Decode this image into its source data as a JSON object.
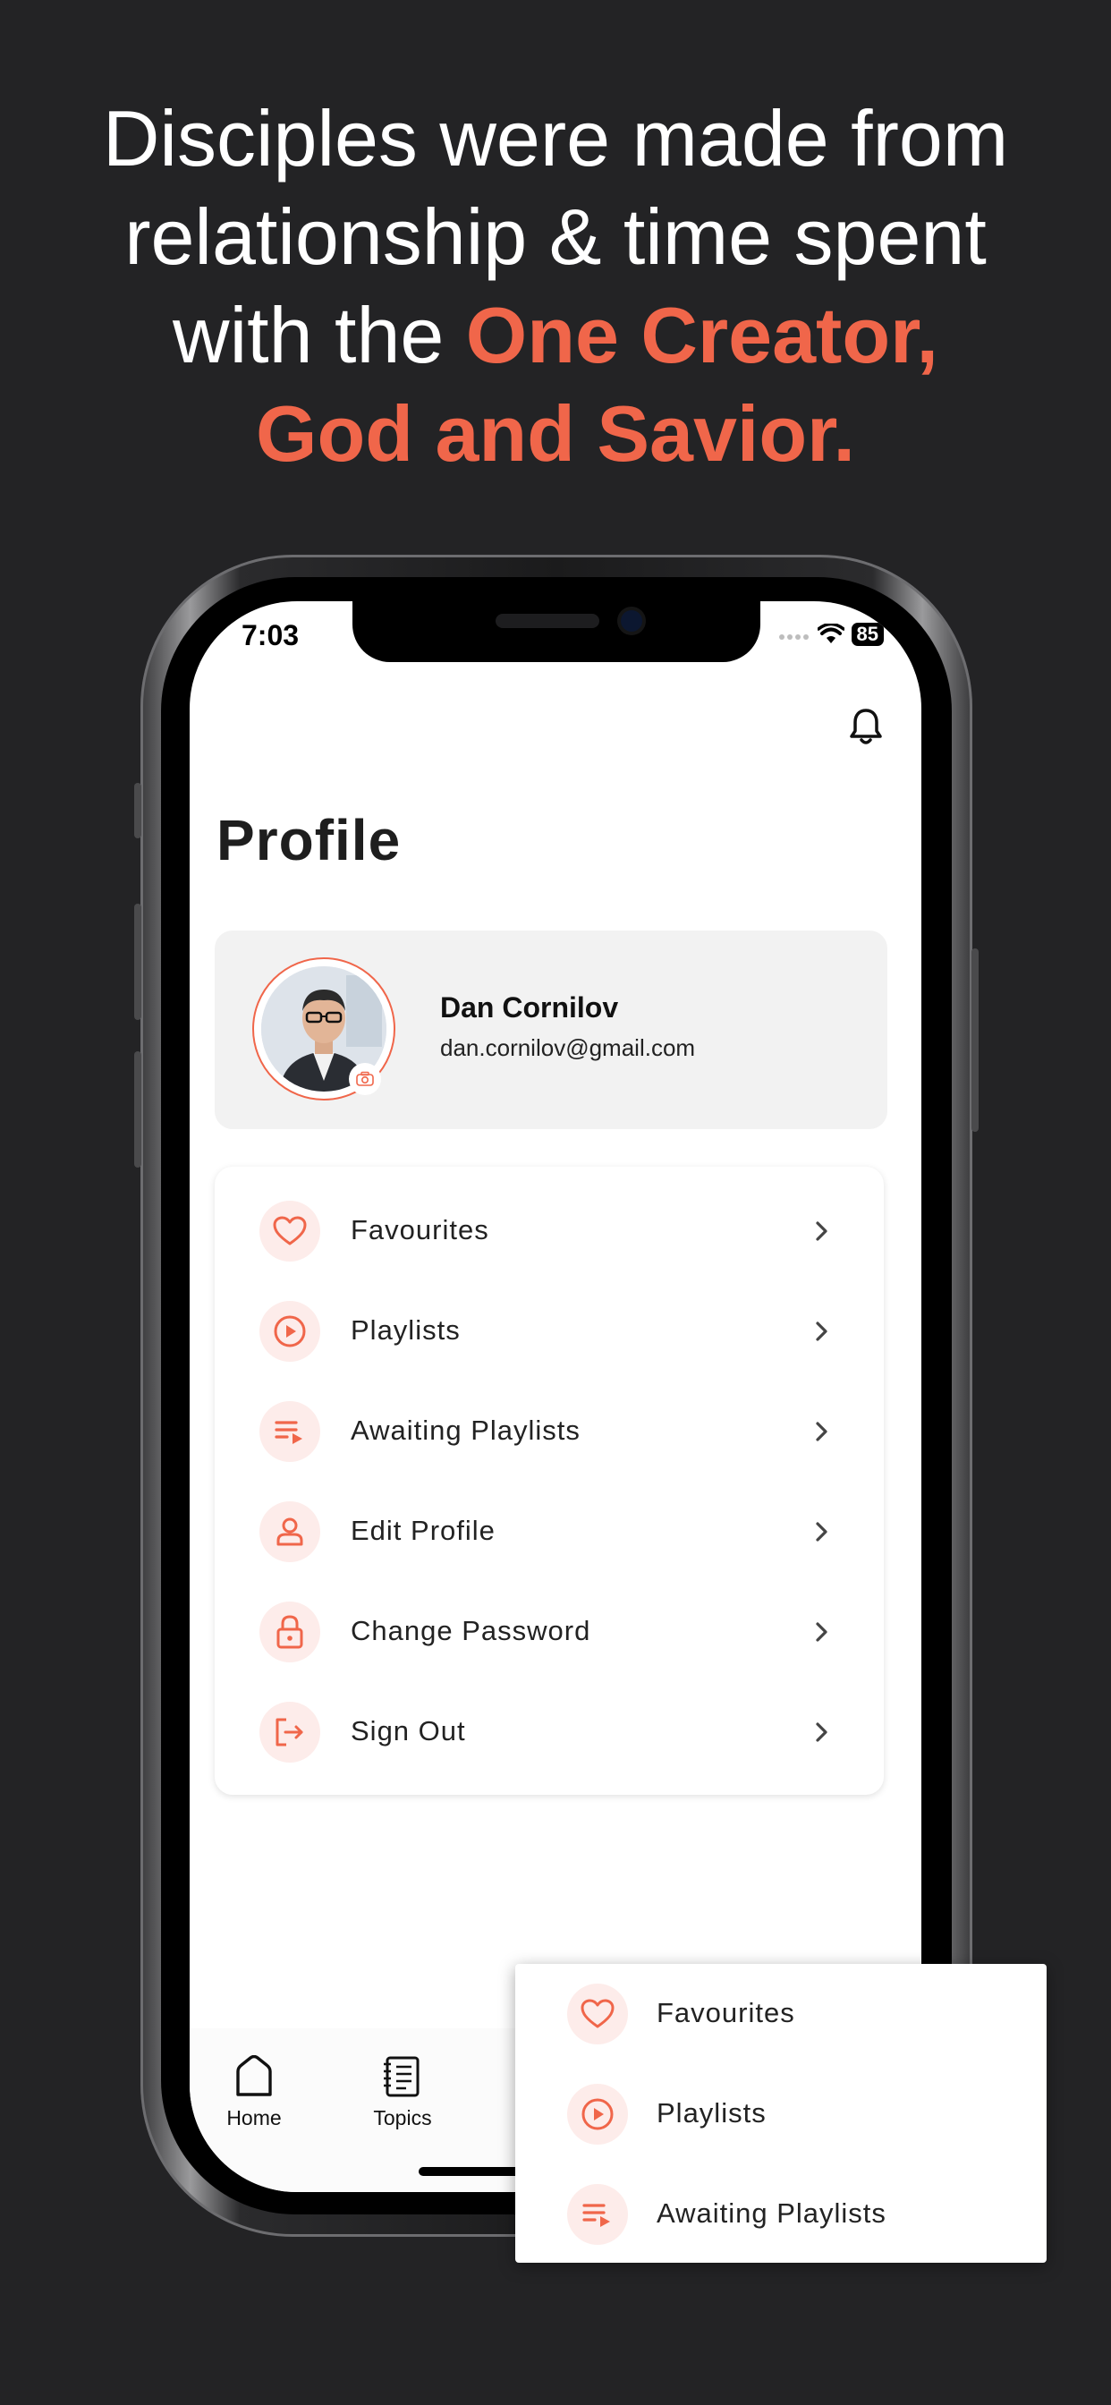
{
  "headline": {
    "line1": "Disciples were made from",
    "line2": "relationship & time spent",
    "line3_plain": "with the ",
    "line3_accent": "One Creator,",
    "line4_accent": "God and Savior."
  },
  "status_bar": {
    "time": "7:03",
    "battery": "85"
  },
  "page": {
    "title": "Profile"
  },
  "profile": {
    "name": "Dan Cornilov",
    "email": "dan.cornilov@gmail.com"
  },
  "menu": [
    {
      "label": "Favourites",
      "icon": "heart-icon"
    },
    {
      "label": "Playlists",
      "icon": "play-circle-icon"
    },
    {
      "label": "Awaiting Playlists",
      "icon": "queue-icon"
    },
    {
      "label": "Edit Profile",
      "icon": "user-icon"
    },
    {
      "label": "Change Password",
      "icon": "lock-icon"
    },
    {
      "label": "Sign Out",
      "icon": "sign-out-icon"
    }
  ],
  "tabs": [
    {
      "label": "Home",
      "icon": "home-icon"
    },
    {
      "label": "Topics",
      "icon": "topics-icon"
    }
  ],
  "popup_menu": [
    {
      "label": "Favourites",
      "icon": "heart-icon"
    },
    {
      "label": "Playlists",
      "icon": "play-circle-icon"
    },
    {
      "label": "Awaiting Playlists",
      "icon": "queue-icon"
    }
  ],
  "colors": {
    "accent": "#f0664a",
    "background": "#232325",
    "icon_bg": "#fdecea"
  }
}
